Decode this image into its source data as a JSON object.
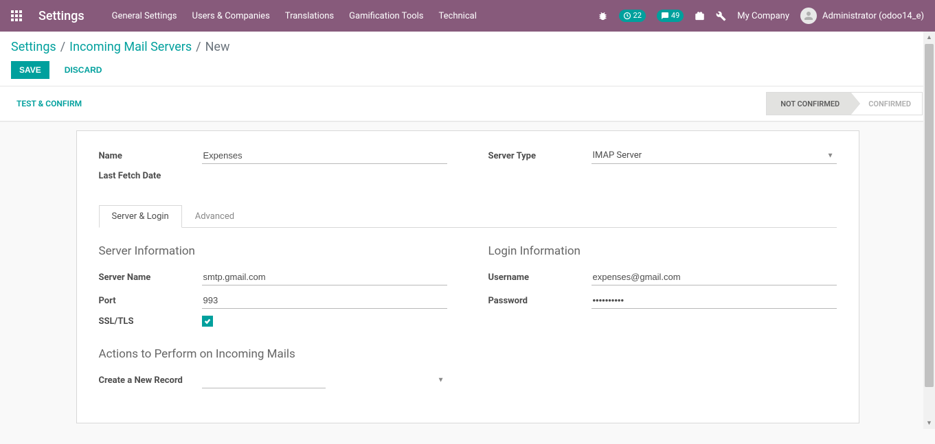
{
  "navbar": {
    "brand": "Settings",
    "menu": [
      "General Settings",
      "Users & Companies",
      "Translations",
      "Gamification Tools",
      "Technical"
    ],
    "clock_badge": "22",
    "chat_badge": "49",
    "company": "My Company",
    "user": "Administrator (odoo14_e)"
  },
  "breadcrumb": {
    "items": [
      "Settings",
      "Incoming Mail Servers"
    ],
    "current": "New"
  },
  "buttons": {
    "save": "Save",
    "discard": "Discard",
    "test_confirm": "Test & Confirm"
  },
  "status": {
    "not_confirmed": "Not Confirmed",
    "confirmed": "Confirmed"
  },
  "form": {
    "labels": {
      "name": "Name",
      "last_fetch_date": "Last Fetch Date",
      "server_type": "Server Type",
      "server_name": "Server Name",
      "port": "Port",
      "ssl_tls": "SSL/TLS",
      "username": "Username",
      "password": "Password",
      "create_new_record": "Create a New Record"
    },
    "values": {
      "name": "Expenses",
      "server_type": "IMAP Server",
      "server_name": "smtp.gmail.com",
      "port": "993",
      "ssl_tls_checked": true,
      "username": "expenses@gmail.com",
      "password": "••••••••••",
      "create_new_record": ""
    },
    "sections": {
      "server_info": "Server Information",
      "login_info": "Login Information",
      "actions": "Actions to Perform on Incoming Mails"
    },
    "tabs": {
      "server_login": "Server & Login",
      "advanced": "Advanced"
    }
  }
}
